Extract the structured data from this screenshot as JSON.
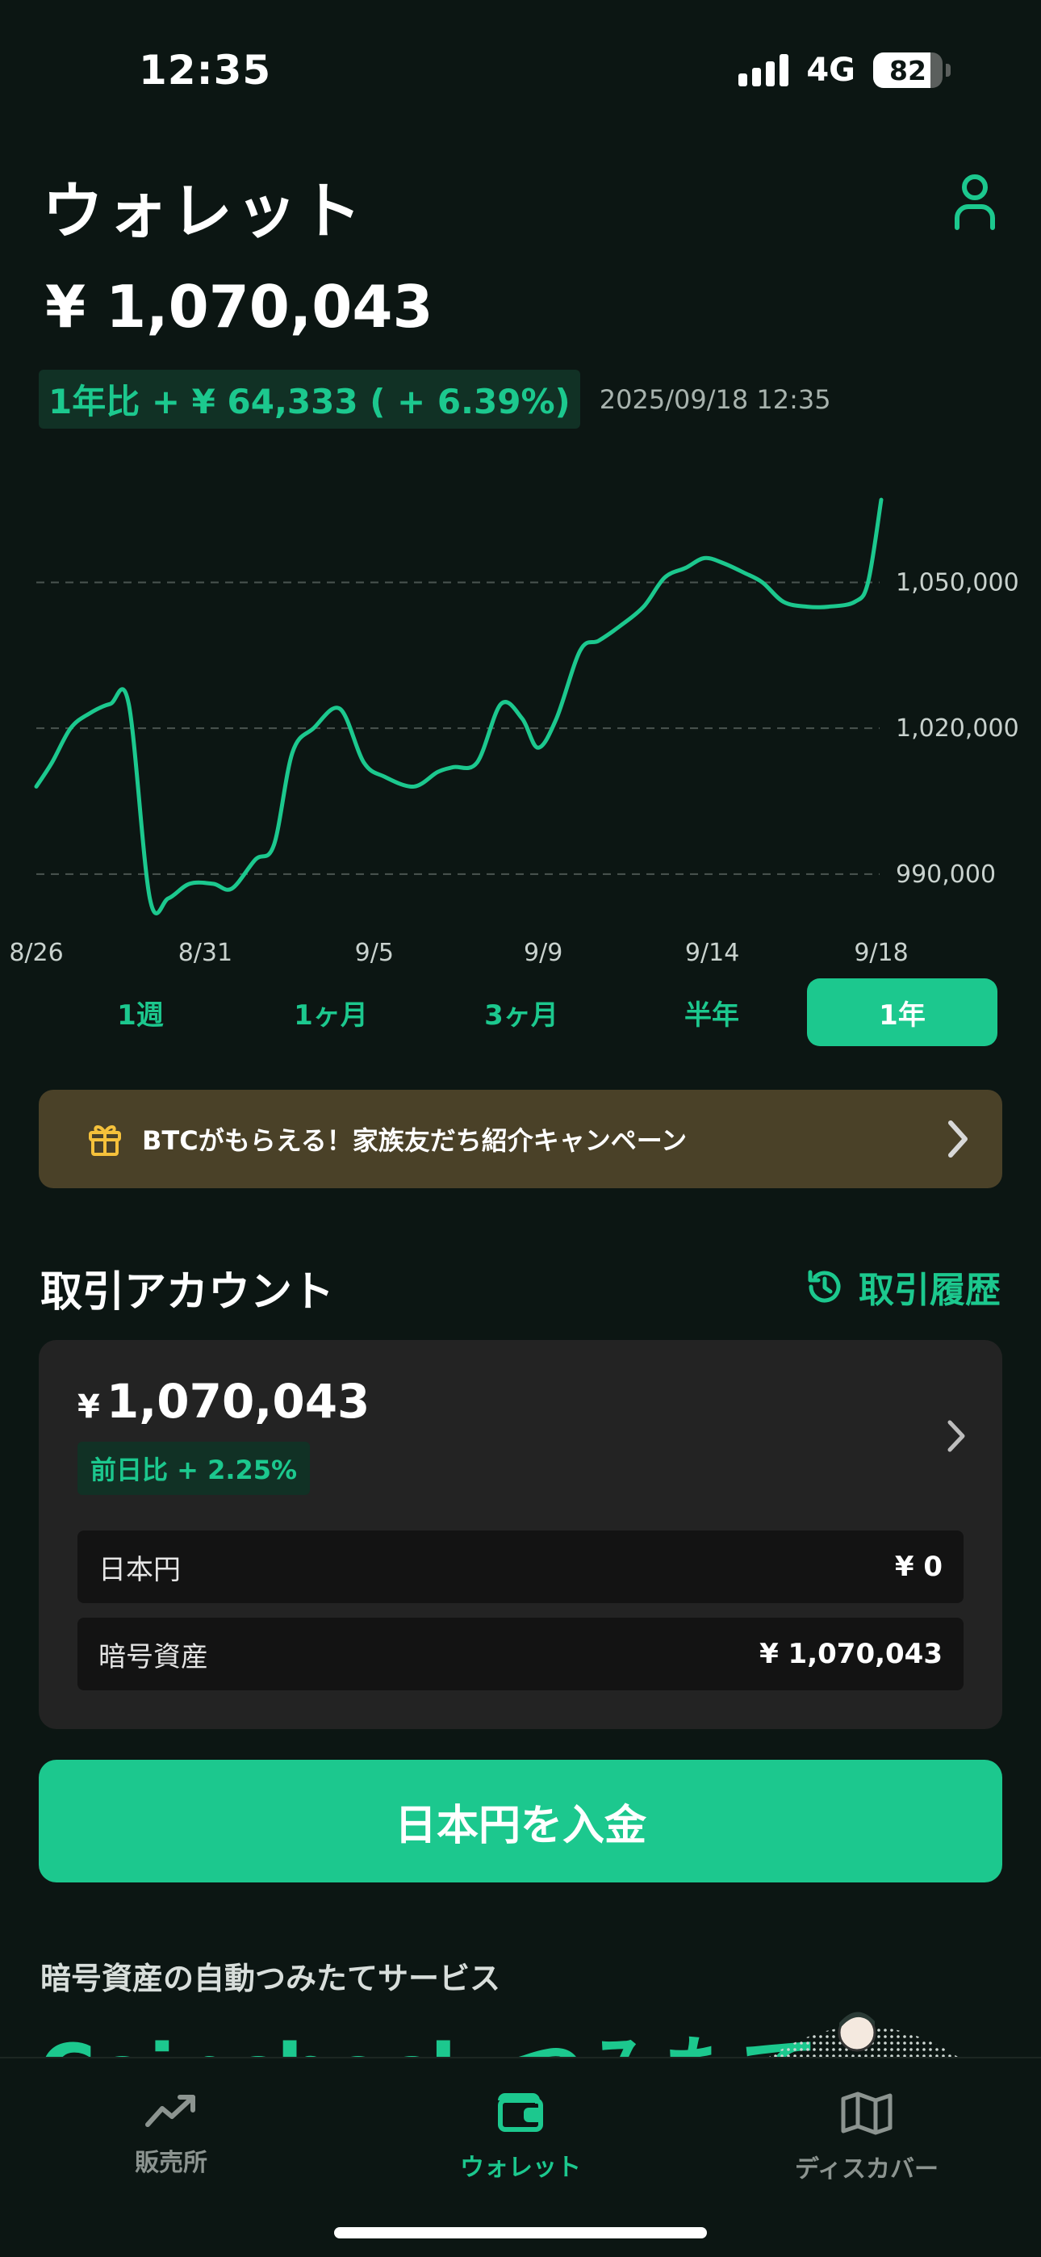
{
  "status": {
    "time": "12:35",
    "network": "4G",
    "battery": "82",
    "battery_level": 0.82
  },
  "header": {
    "title": "ウォレット"
  },
  "balance": {
    "total": "¥ 1,070,043",
    "change": "1年比 + ¥ 64,333 ( + 6.39%)",
    "timestamp": "2025/09/18 12:35"
  },
  "chart_data": {
    "type": "line",
    "x_labels": [
      "8/26",
      "8/31",
      "9/5",
      "9/9",
      "9/14",
      "9/18"
    ],
    "y_ticks": [
      1050000,
      1020000,
      990000
    ],
    "y_tick_labels": [
      "1,050,000",
      "1,020,000",
      "990,000"
    ],
    "ylim": [
      983000,
      1071000
    ],
    "grid": true,
    "color": "#1cc88e",
    "points": [
      [
        0,
        1008000
      ],
      [
        0.6,
        1013000
      ],
      [
        1.3,
        1020000
      ],
      [
        2.0,
        1023000
      ],
      [
        2.8,
        1025000
      ],
      [
        3.5,
        1025000
      ],
      [
        4.3,
        985000
      ],
      [
        5.0,
        985000
      ],
      [
        5.8,
        988000
      ],
      [
        6.7,
        988000
      ],
      [
        7.4,
        987000
      ],
      [
        8.3,
        993000
      ],
      [
        9.0,
        996000
      ],
      [
        9.7,
        1015000
      ],
      [
        10.5,
        1020000
      ],
      [
        11.5,
        1024000
      ],
      [
        12.4,
        1013000
      ],
      [
        13.2,
        1010000
      ],
      [
        14.3,
        1008000
      ],
      [
        15.2,
        1011000
      ],
      [
        15.8,
        1012000
      ],
      [
        16.7,
        1013000
      ],
      [
        17.6,
        1025000
      ],
      [
        18.4,
        1022000
      ],
      [
        19.0,
        1016000
      ],
      [
        19.7,
        1022000
      ],
      [
        20.6,
        1036000
      ],
      [
        21.3,
        1038000
      ],
      [
        22.1,
        1041000
      ],
      [
        23.0,
        1045000
      ],
      [
        23.8,
        1051000
      ],
      [
        24.6,
        1053000
      ],
      [
        25.3,
        1055000
      ],
      [
        26.0,
        1054000
      ],
      [
        26.8,
        1052000
      ],
      [
        27.5,
        1050000
      ],
      [
        28.3,
        1046000
      ],
      [
        29.2,
        1045000
      ],
      [
        30.0,
        1045000
      ],
      [
        31.0,
        1046000
      ],
      [
        31.5,
        1050000
      ],
      [
        32.0,
        1067000
      ]
    ]
  },
  "ranges": [
    {
      "label": "1週",
      "active": false
    },
    {
      "label": "1ヶ月",
      "active": false
    },
    {
      "label": "3ヶ月",
      "active": false
    },
    {
      "label": "半年",
      "active": false
    },
    {
      "label": "1年",
      "active": true
    }
  ],
  "banner": {
    "text": "BTCがもらえる！家族友だち紹介キャンペーン",
    "icon": "gift-icon"
  },
  "account": {
    "section_title": "取引アカウント",
    "history_label": "取引履歴",
    "yen_symbol": "¥",
    "total": "1,070,043",
    "day_change": "前日比 + 2.25%",
    "rows": [
      {
        "label": "日本円",
        "value": "¥ 0"
      },
      {
        "label": "暗号資産",
        "value": "¥ 1,070,043"
      }
    ]
  },
  "deposit_label": "日本円を入金",
  "promo": {
    "subtitle": "暗号資産の自動つみたてサービス",
    "title": "Coincheck つみたて"
  },
  "tabs": [
    {
      "label": "販売所",
      "icon": "trend-icon",
      "active": false
    },
    {
      "label": "ウォレット",
      "icon": "wallet-icon",
      "active": true
    },
    {
      "label": "ディスカバー",
      "icon": "map-icon",
      "active": false
    }
  ],
  "colors": {
    "accent": "#1cc88e",
    "background": "#0c1613",
    "card": "#232323",
    "banner": "#4a4128"
  }
}
